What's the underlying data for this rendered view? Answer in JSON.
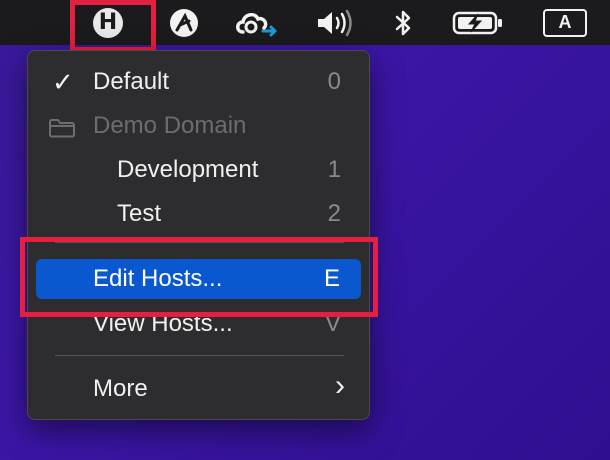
{
  "menubar": {
    "icons": [
      "h-app-icon",
      "sketch-icon",
      "cloud-sync-icon",
      "volume-icon",
      "bluetooth-icon",
      "battery-charging-icon"
    ],
    "input_source_label": "A",
    "h_letter": "H"
  },
  "menu": {
    "items": [
      {
        "label": "Default",
        "shortcut": "0",
        "checked": true
      },
      {
        "label": "Demo Domain",
        "disabled": true
      },
      {
        "label": "Development",
        "shortcut": "1"
      },
      {
        "label": "Test",
        "shortcut": "2"
      },
      {
        "label": "Edit Hosts...",
        "shortcut": "E",
        "selected": true
      },
      {
        "label": "View Hosts...",
        "shortcut": "V"
      },
      {
        "label": "More",
        "submenu": true
      }
    ],
    "checkmark": "✓",
    "submenu_arrow": "›"
  },
  "colors": {
    "highlight_accent": "#e3203f",
    "selection_blue": "#0a58d0",
    "menu_bg": "#2d2d2f",
    "desktop": "#3a1a9a"
  }
}
